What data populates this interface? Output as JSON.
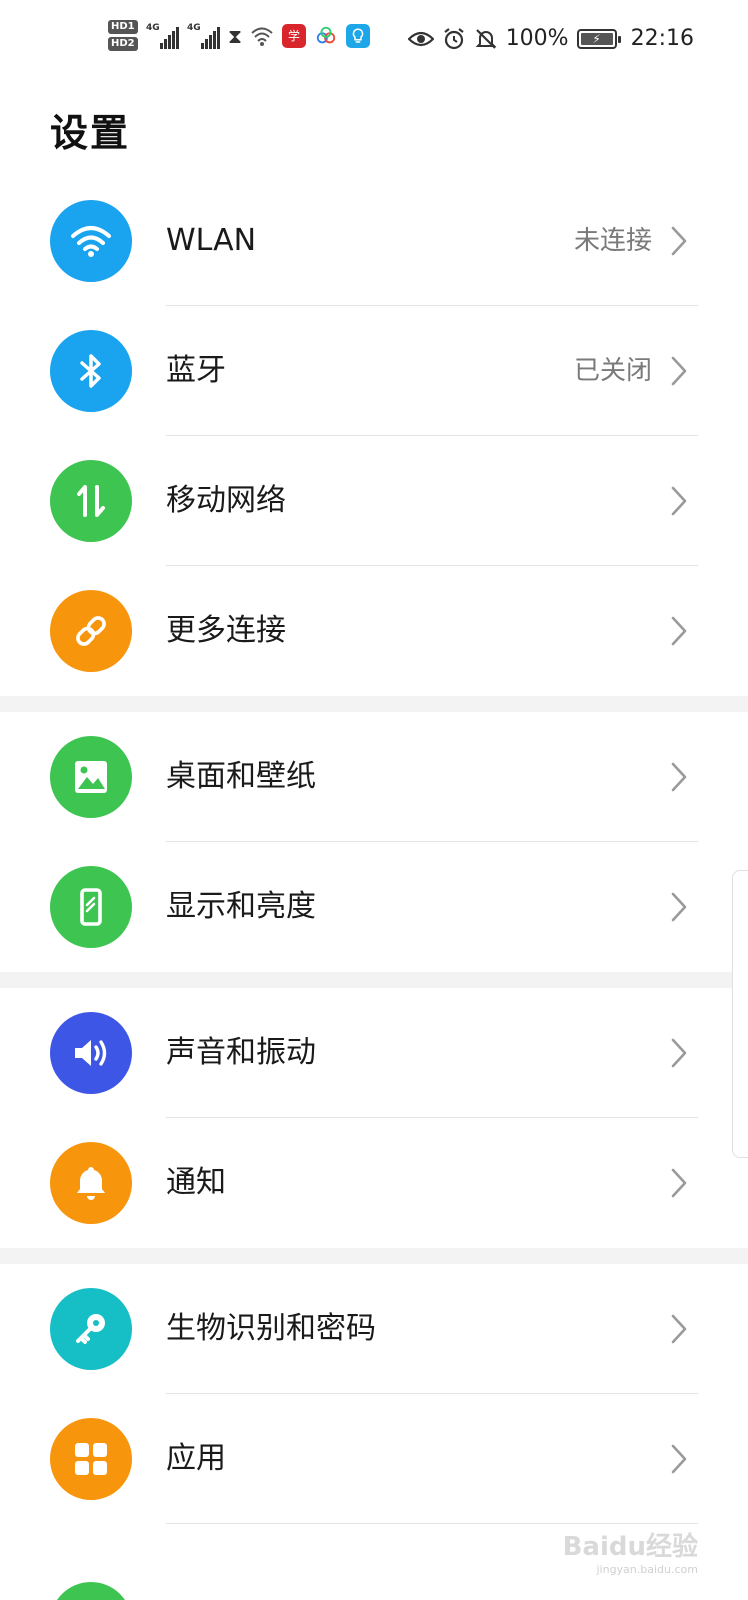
{
  "statusbar": {
    "hd1": "HD1",
    "hd2": "HD2",
    "net1": "4G",
    "net2": "4G",
    "battery_percent": "100%",
    "time": "22:16",
    "app1_glyph": "学",
    "app1_color": "#d9262c",
    "app2_color": "#2f80ed",
    "app3_color": "#1ea7e8"
  },
  "page": {
    "title": "设置"
  },
  "groups": [
    {
      "items": [
        {
          "label": "WLAN",
          "value": "未连接",
          "icon": "wifi-icon",
          "color": "#1aa3ef"
        },
        {
          "label": "蓝牙",
          "value": "已关闭",
          "icon": "bluetooth-icon",
          "color": "#1aa3ef"
        },
        {
          "label": "移动网络",
          "value": "",
          "icon": "mobile-data-icon",
          "color": "#3dc451"
        },
        {
          "label": "更多连接",
          "value": "",
          "icon": "link-icon",
          "color": "#f7950d"
        }
      ]
    },
    {
      "items": [
        {
          "label": "桌面和壁纸",
          "value": "",
          "icon": "picture-icon",
          "color": "#3dc451"
        },
        {
          "label": "显示和亮度",
          "value": "",
          "icon": "phone-display-icon",
          "color": "#3dc451"
        }
      ]
    },
    {
      "items": [
        {
          "label": "声音和振动",
          "value": "",
          "icon": "speaker-icon",
          "color": "#3e56e6"
        },
        {
          "label": "通知",
          "value": "",
          "icon": "bell-icon",
          "color": "#f7950d"
        }
      ]
    },
    {
      "items": [
        {
          "label": "生物识别和密码",
          "value": "",
          "icon": "key-icon",
          "color": "#16bfc6"
        },
        {
          "label": "应用",
          "value": "",
          "icon": "apps-grid-icon",
          "color": "#f7950d"
        }
      ]
    }
  ],
  "watermark": {
    "text": "Baidu经验",
    "sub": "jingyan.baidu.com"
  }
}
